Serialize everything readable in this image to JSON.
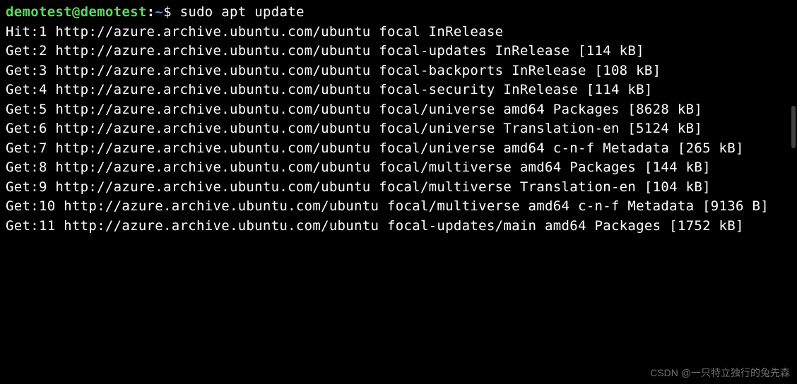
{
  "prompt": {
    "user": "demotest",
    "at": "@",
    "host": "demotest",
    "sep": ":",
    "path": "~",
    "dollar": "$"
  },
  "command": "sudo apt update",
  "output": [
    "Hit:1 http://azure.archive.ubuntu.com/ubuntu focal InRelease",
    "Get:2 http://azure.archive.ubuntu.com/ubuntu focal-updates InRelease [114 kB]",
    "Get:3 http://azure.archive.ubuntu.com/ubuntu focal-backports InRelease [108 kB]",
    "Get:4 http://azure.archive.ubuntu.com/ubuntu focal-security InRelease [114 kB]",
    "Get:5 http://azure.archive.ubuntu.com/ubuntu focal/universe amd64 Packages [8628 kB]",
    "Get:6 http://azure.archive.ubuntu.com/ubuntu focal/universe Translation-en [5124 kB]",
    "Get:7 http://azure.archive.ubuntu.com/ubuntu focal/universe amd64 c-n-f Metadata [265 kB]",
    "Get:8 http://azure.archive.ubuntu.com/ubuntu focal/multiverse amd64 Packages [144 kB]",
    "Get:9 http://azure.archive.ubuntu.com/ubuntu focal/multiverse Translation-en [104 kB]",
    "Get:10 http://azure.archive.ubuntu.com/ubuntu focal/multiverse amd64 c-n-f Metadata [9136 B]",
    "Get:11 http://azure.archive.ubuntu.com/ubuntu focal-updates/main amd64 Packages [1752 kB]"
  ],
  "watermark": "CSDN @一只特立独行的兔先森"
}
